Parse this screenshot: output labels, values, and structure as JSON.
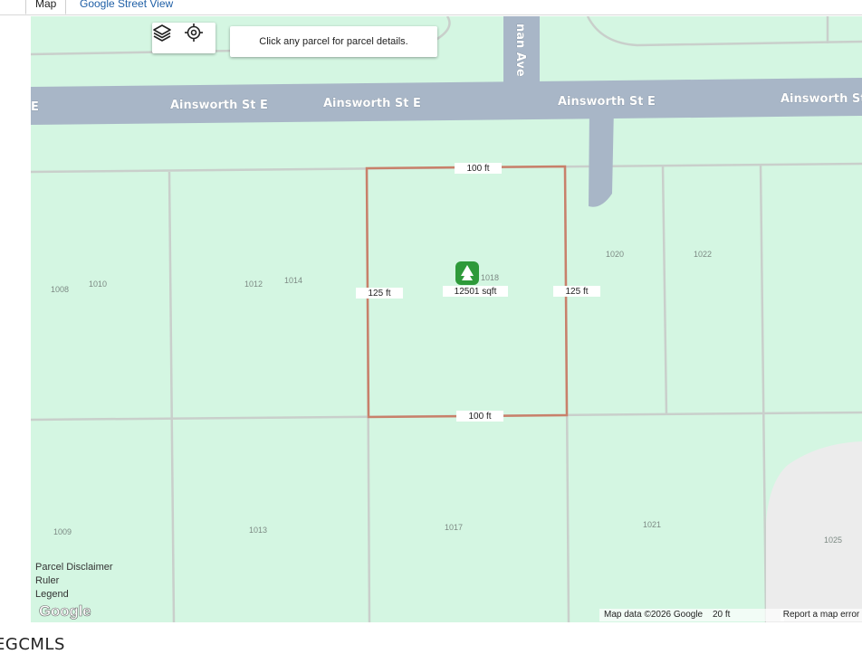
{
  "tabs": [
    {
      "label": "Map",
      "active": true
    },
    {
      "label": "Google Street View",
      "active": false
    }
  ],
  "map": {
    "hint": "Click any parcel for parcel details.",
    "roads": {
      "ainsworth_labels": [
        "E",
        "Ainsworth St E",
        "Ainsworth St E",
        "Ainsworth St E",
        "Ainsworth St"
      ],
      "ave_label": "nan Ave"
    },
    "parcel": {
      "top_dim": "100 ft",
      "bottom_dim": "100 ft",
      "left_dim": "125 ft",
      "right_dim": "125 ft",
      "area": "12501 sqft",
      "number": "1018"
    },
    "parcel_numbers": [
      "1008",
      "1010",
      "1012",
      "1014",
      "1020",
      "1022",
      "1009",
      "1013",
      "1017",
      "1021",
      "1025"
    ],
    "left_links": [
      "Parcel Disclaimer",
      "Ruler",
      "Legend"
    ],
    "google_logo": "Google",
    "attribution": "Map data ©2026 Google",
    "scale": "20 ft",
    "report": "Report a map error"
  },
  "footer": {
    "mls": "EGCMLS"
  },
  "colors": {
    "land": "#d4f6e2",
    "road": "#a8b6c7",
    "parcel_border": "#c8806a",
    "lot_line": "#c9cfcb",
    "pin": "#2e9a3a"
  }
}
